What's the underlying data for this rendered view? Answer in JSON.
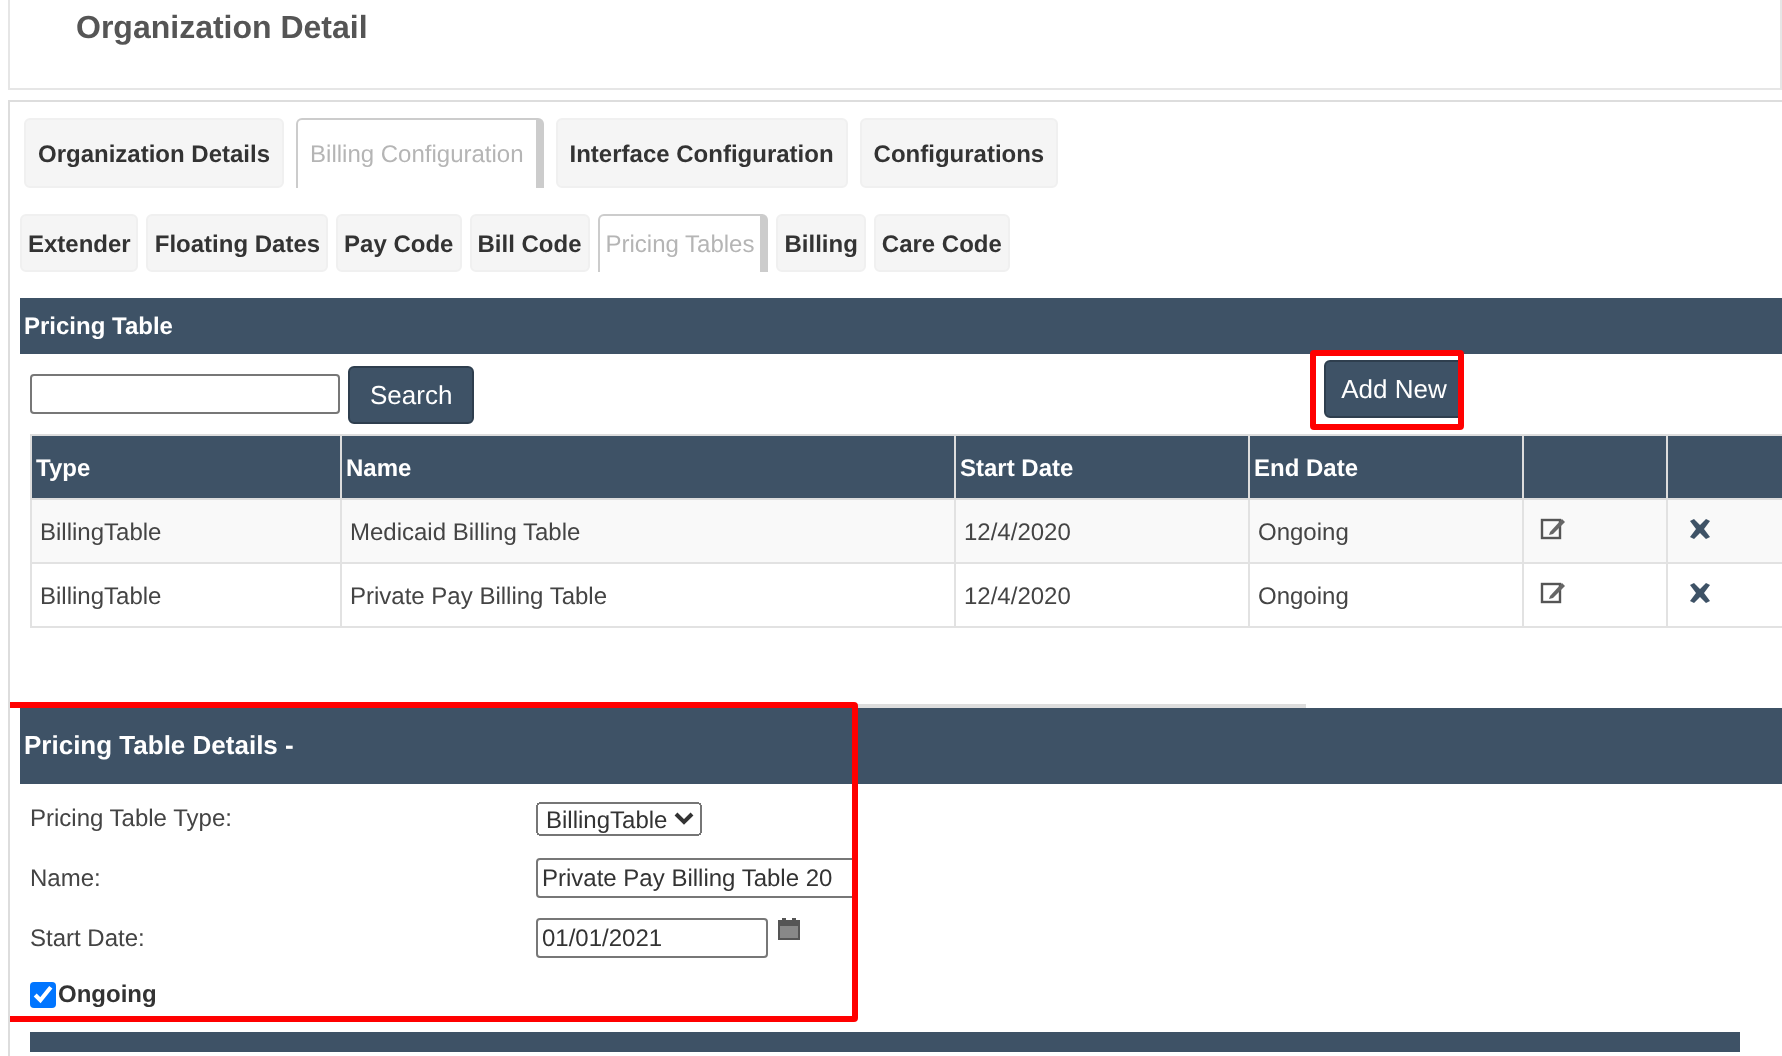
{
  "page": {
    "title": "Organization Detail"
  },
  "main_tabs": [
    {
      "label": "Organization Details",
      "selected": false
    },
    {
      "label": "Billing Configuration",
      "selected": true
    },
    {
      "label": "Interface Configuration",
      "selected": false
    },
    {
      "label": "Configurations",
      "selected": false
    }
  ],
  "sub_tabs": [
    {
      "label": "Extender",
      "selected": false
    },
    {
      "label": "Floating Dates",
      "selected": false
    },
    {
      "label": "Pay Code",
      "selected": false
    },
    {
      "label": "Bill Code",
      "selected": false
    },
    {
      "label": "Pricing Tables",
      "selected": true
    },
    {
      "label": "Billing",
      "selected": false
    },
    {
      "label": "Care Code",
      "selected": false
    }
  ],
  "pricing_table": {
    "title": "Pricing Table",
    "search_button": "Search",
    "add_button": {
      "label": "Add New",
      "highlighted": true
    },
    "columns": [
      "Type",
      "Name",
      "Start Date",
      "End Date"
    ],
    "rows": [
      {
        "type": "BillingTable",
        "name": "Medicaid Billing Table",
        "start_date": "12/4/2020",
        "end_date": "Ongoing"
      },
      {
        "type": "BillingTable",
        "name": "Private Pay Billing Table",
        "start_date": "12/4/2020",
        "end_date": "Ongoing"
      }
    ]
  },
  "details": {
    "title": "Pricing Table Details -",
    "highlighted": true,
    "fields": [
      {
        "kind": "select",
        "label": "Pricing Table Type:",
        "value": "BillingTable"
      },
      {
        "kind": "text",
        "label": "Name:",
        "value": "Private Pay Billing Table 20"
      },
      {
        "kind": "date",
        "label": "Start Date:",
        "value": "01/01/2021"
      }
    ],
    "ongoing": {
      "label": "Ongoing",
      "checked": true
    }
  }
}
